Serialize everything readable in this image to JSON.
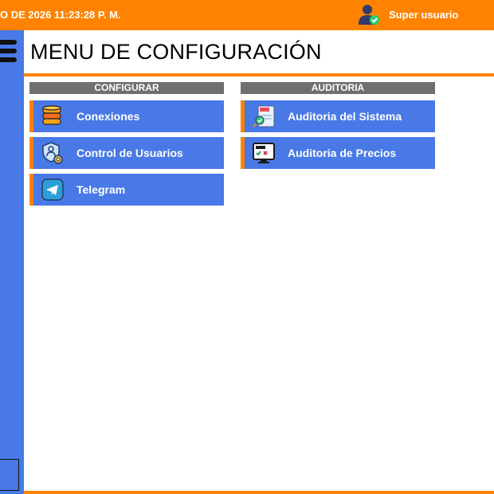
{
  "topbar": {
    "datetime": "O DE 2026 11:23:28 P. M.",
    "username": "Super usuario",
    "user_icon": "user-check-icon"
  },
  "sidebar": {
    "menu_icon": "hamburger-icon"
  },
  "page": {
    "title": "MENU DE CONFIGURACIÓN"
  },
  "sections": {
    "configurar": {
      "header": "CONFIGURAR",
      "items": [
        {
          "label": "Conexiones",
          "icon": "database-icon"
        },
        {
          "label": "Control de Usuarios",
          "icon": "user-shield-gear-icon"
        },
        {
          "label": "Telegram",
          "icon": "telegram-icon"
        }
      ]
    },
    "auditoria": {
      "header": "AUDITORIA",
      "items": [
        {
          "label": "Auditoria del Sistema",
          "icon": "audit-document-icon"
        },
        {
          "label": "Auditoria de Precios",
          "icon": "audit-monitor-icon"
        }
      ]
    }
  },
  "colors": {
    "accent_orange": "#ff8200",
    "card_blue": "#4879e6",
    "section_header_gray": "#6f6f6f"
  }
}
